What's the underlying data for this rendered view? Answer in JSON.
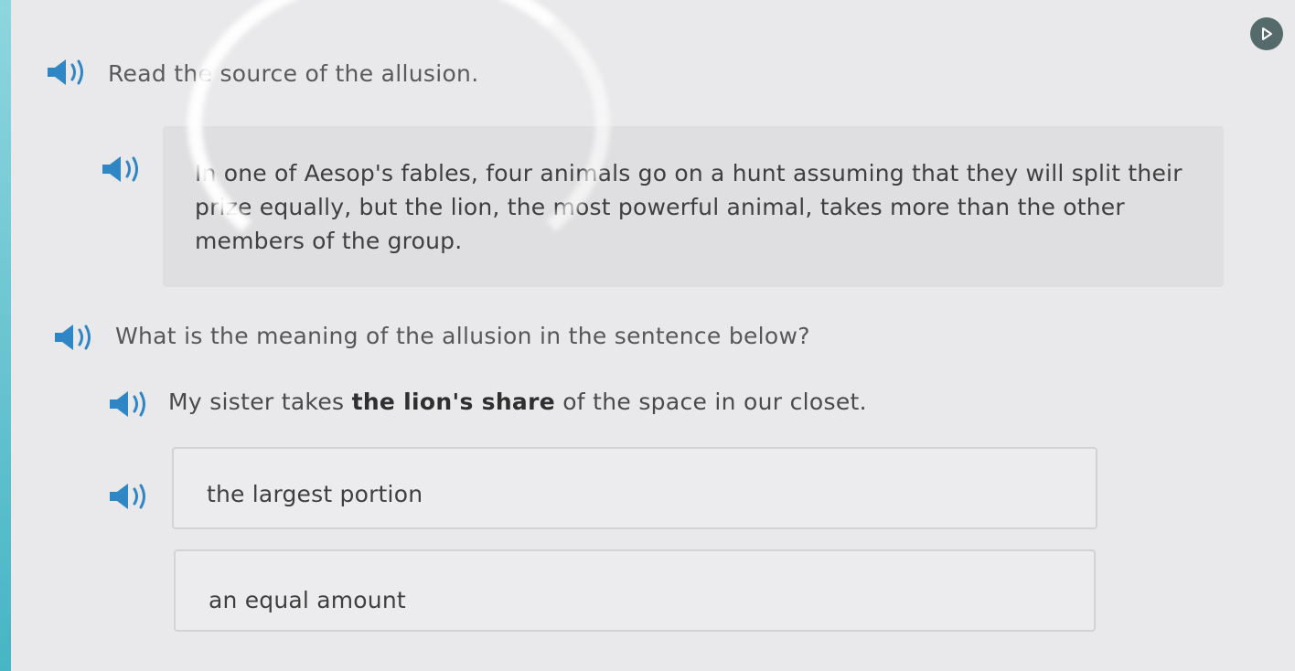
{
  "instruction": {
    "text": "Read the source of the allusion."
  },
  "source": {
    "text": "In one of Aesop's fables, four animals go on a hunt assuming that they will split their prize equally, but the lion, the most powerful animal, takes more than the other members of the group."
  },
  "question": {
    "text": "What is the meaning of the allusion in the sentence below?"
  },
  "sentence": {
    "before": "My sister takes ",
    "highlight": "the lion's share",
    "after": " of the space in our closet."
  },
  "choices": [
    {
      "label": "the largest portion"
    },
    {
      "label": "an equal amount"
    }
  ],
  "icons": {
    "audio": "speaker-icon",
    "corner": "play-icon"
  },
  "colors": {
    "accent": "#2f86c4",
    "corner_button": "#556a6a",
    "edge": "#47b5c4"
  }
}
